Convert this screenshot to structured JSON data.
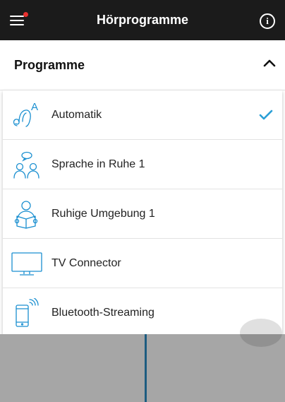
{
  "app": {
    "title": "Hörprogramme",
    "info_icon": "info-icon",
    "menu_icon": "hamburger-menu-icon",
    "notification_color": "#e8302e"
  },
  "section": {
    "title": "Programme",
    "toggle_icon": "chevron-up-icon"
  },
  "programs": [
    {
      "label": "Automatik",
      "icon": "hearing-aid-auto-icon",
      "selected": true
    },
    {
      "label": "Sprache in Ruhe 1",
      "icon": "conversation-people-icon",
      "selected": false
    },
    {
      "label": "Ruhige Umgebung 1",
      "icon": "person-reading-icon",
      "selected": false
    },
    {
      "label": "TV Connector",
      "icon": "tv-icon",
      "selected": false
    },
    {
      "label": "Bluetooth-Streaming",
      "icon": "phone-streaming-icon",
      "selected": false
    }
  ],
  "colors": {
    "accent": "#2a9fd6",
    "icon": "#1a8fd0",
    "header_bg": "#1b1b1b"
  }
}
